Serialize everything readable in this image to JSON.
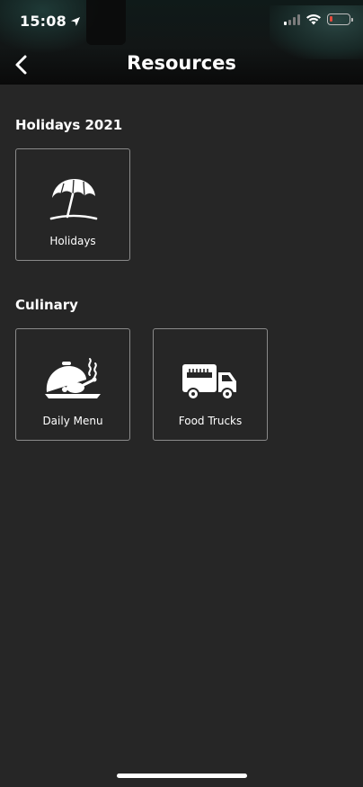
{
  "status_bar": {
    "time": "15:08",
    "location_icon": "location-arrow-icon",
    "wifi_icon": "wifi-icon",
    "battery_level_fraction": 0.15,
    "battery_color": "#e54b3c"
  },
  "nav": {
    "title": "Resources",
    "back_icon": "chevron-left-icon"
  },
  "sections": [
    {
      "title": "Holidays 2021",
      "tiles": [
        {
          "label": "Holidays",
          "icon": "beach-umbrella-icon"
        }
      ]
    },
    {
      "title": "Culinary",
      "tiles": [
        {
          "label": "Daily Menu",
          "icon": "food-platter-icon"
        },
        {
          "label": "Food Trucks",
          "icon": "food-truck-icon"
        }
      ]
    }
  ],
  "colors": {
    "background": "#262626",
    "tile_border": "#8a8a8a",
    "text": "#ffffff"
  }
}
